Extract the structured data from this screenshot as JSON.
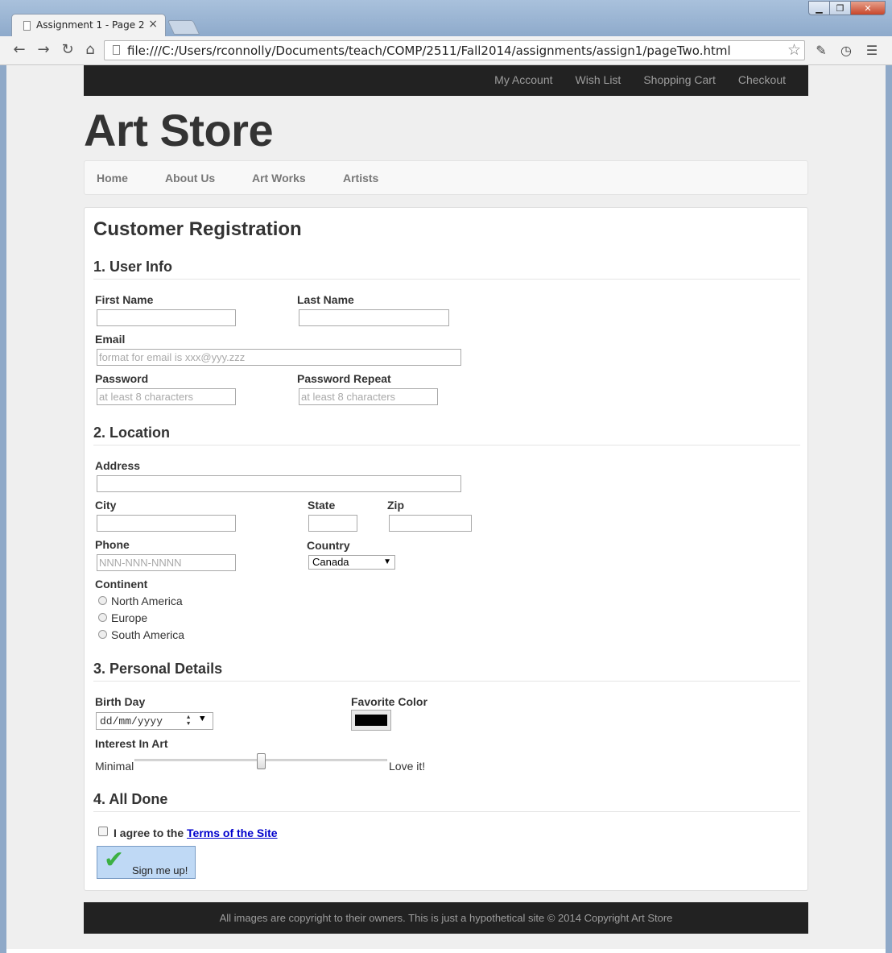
{
  "browser": {
    "tab_title": "Assignment 1 - Page 2",
    "tab_close": "×",
    "url": "file:///C:/Users/rconnolly/Documents/teach/COMP/2511/Fall2014/assignments/assign1/pageTwo.html",
    "back_icon": "back-arrow-icon",
    "forward_icon": "forward-arrow-icon",
    "reload_icon": "reload-icon",
    "home_icon": "home-icon",
    "back_glyph": "←",
    "forward_glyph": "→",
    "reload_glyph": "↻",
    "home_glyph": "⌂",
    "star_glyph": "☆",
    "menu_glyph": "☰",
    "clock_glyph": "◷",
    "eyedropper_glyph": "✎",
    "min_glyph": "▁",
    "max_glyph": "❐",
    "close_glyph": "✕"
  },
  "topbar": {
    "links": [
      "My Account",
      "Wish List",
      "Shopping Cart",
      "Checkout"
    ]
  },
  "brand": "Art Store",
  "mainnav": {
    "items": [
      "Home",
      "About Us",
      "Art Works",
      "Artists"
    ]
  },
  "form": {
    "title": "Customer Registration",
    "sections": {
      "user_info": "1. User Info",
      "location": "2. Location",
      "personal": "3. Personal Details",
      "done": "4. All Done"
    },
    "labels": {
      "first_name": "First Name",
      "last_name": "Last Name",
      "email": "Email",
      "password": "Password",
      "password_repeat": "Password Repeat",
      "address": "Address",
      "city": "City",
      "state": "State",
      "zip": "Zip",
      "phone": "Phone",
      "country": "Country",
      "continent": "Continent",
      "birth_day": "Birth Day",
      "favorite_color": "Favorite Color",
      "interest": "Interest In Art"
    },
    "placeholders": {
      "email": "format for email is xxx@yyy.zzz",
      "password": "at least 8 characters",
      "password_repeat": "at least 8 characters",
      "phone": "NNN-NNN-NNNN"
    },
    "country_selected": "Canada",
    "continents": [
      "North America",
      "Europe",
      "South America"
    ],
    "birthday_format": "dd/mm/yyyy",
    "favorite_color_value": "#000000",
    "interest_min_label": "Minimal",
    "interest_max_label": "Love it!",
    "interest_value": 0.5,
    "agree_prefix": "I agree to the",
    "terms_link": "Terms of the Site",
    "submit_label": "Sign me up!"
  },
  "footer": "All images are copyright to their owners. This is just a hypothetical site © 2014 Copyright Art Store",
  "colors": {
    "topbar_bg": "#222222",
    "link_blue": "#0000cc",
    "submit_bg": "#bfd9f5",
    "check_green": "#3cb043"
  }
}
